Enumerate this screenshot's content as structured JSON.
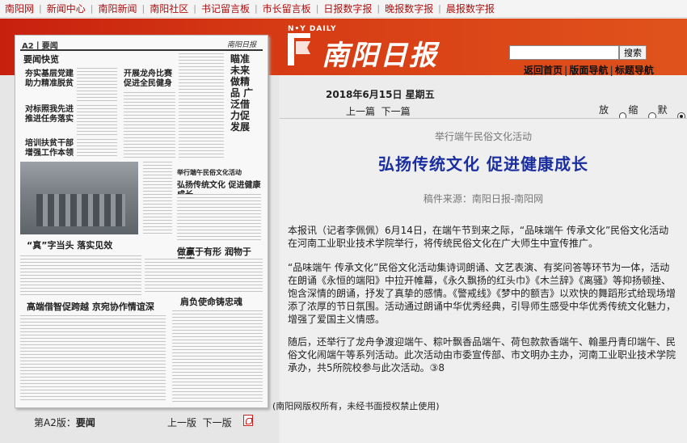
{
  "topnav": [
    "南阳网",
    "新闻中心",
    "南阳新闻",
    "南阳社区",
    "书记留言板",
    "市长留言板",
    "日报数字报",
    "晚报数字报",
    "晨报数字报"
  ],
  "header": {
    "logo_small": "N•Y DAILY",
    "logo_title": "南阳日报",
    "search_placeholder": "",
    "search_button": "搜索",
    "links": [
      "返回首页",
      "版面导航",
      "标题导航"
    ]
  },
  "newspaper": {
    "page_label": "A2丨要闻",
    "masthead": "南阳日报",
    "headlines": [
      "要闻快览",
      "夯实基层党建 助力精准脱贫",
      "开展龙舟比赛 促进全民健身",
      "对标照我先进 推进任务落实",
      "培训扶贫干部 增强工作本领",
      "瞄准未来做精品 广泛借力促发展",
      "举行端午民俗文化活动",
      "弘扬传统文化 促进健康成长",
      "“真”字当头 落实见效",
      "做赢于有形 润物于无声",
      "高端借智促跨越 京宛协作情谊深",
      "肩负使命铸忠魂"
    ]
  },
  "edition": {
    "label": "第A2版：",
    "name": "要闻",
    "prev": "上一版",
    "next": "下一版"
  },
  "date": "2018年6月15日 星期五",
  "article_nav": {
    "prev": "上一篇",
    "next": "下一篇"
  },
  "zoom": {
    "enlarge": "放大",
    "shrink": "缩小",
    "default": "默认"
  },
  "article": {
    "subtitle": "举行端午民俗文化活动",
    "title": "弘扬传统文化  促进健康成长",
    "source": "稿件来源：南阳日报-南阳网",
    "paragraphs": [
      "本报讯（记者李佩佩）6月14日，在端午节到来之际，“品味端午 传承文化”民俗文化活动在河南工业职业技术学院举行，将传统民俗文化在广大师生中宣传推广。",
      "“品味端午 传承文化”民俗文化活动集诗词朗诵、文艺表演、有奖问答等环节为一体，活动在朗诵《永恒的端阳》中拉开帷幕，《永久飘扬的红头巾》《木兰辞》《离骚》等抑扬顿挫、饱含深情的朗诵，抒发了真挚的感情。《警戒线》《梦中的额吉》以欢快的舞蹈形式给现场增添了浓厚的节日氛围。活动通过朗诵中华优秀经典，引导师生感受中华优秀传统文化魅力，增强了爱国主义情感。",
      "随后，还举行了龙舟争渡迎端午、粽叶飘香品端午、荷包款款香端午、翰墨丹青印端午、民俗文化闹端午等系列活动。此次活动由市委宣传部、市文明办主办，河南工业职业技术学院承办，共5所院校参与此次活动。③8"
    ]
  },
  "copyright": "(南阳网版权所有，未经书面授权禁止使用)"
}
